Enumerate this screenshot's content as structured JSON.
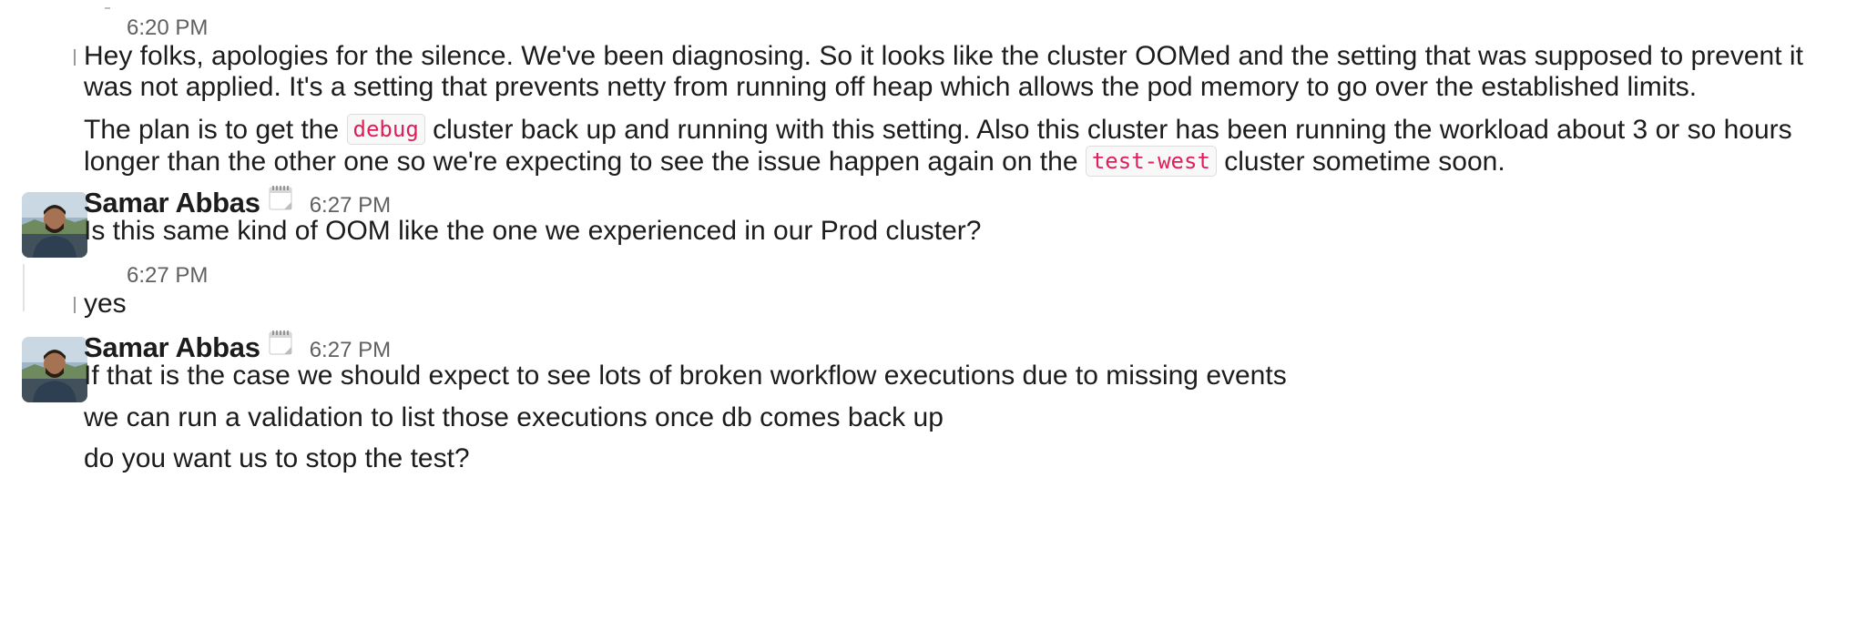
{
  "messages": [
    {
      "timestamp": "6:20 PM",
      "paragraphs": [
        {
          "line1": "Hey folks, apologies for the silence. We've been diagnosing. So it looks like the cluster OOMed and the setting that was supposed to prevent it",
          "line2": "was not applied. It's a setting that prevents netty from running off heap which allows the pod memory to go over the established limits."
        },
        {
          "line1_before": "The plan is to get the ",
          "line1_code": "debug",
          "line1_after": " cluster back up and running with this setting. Also this cluster has been running the workload about 3 or so hours",
          "line2_before": "longer than the other one so we're expecting to see the issue happen again on the ",
          "line2_code": "test-west",
          "line2_after": " cluster sometime soon."
        }
      ]
    },
    {
      "author": "Samar Abbas",
      "status_icon": "calendar-icon",
      "timestamp": "6:27 PM",
      "text": "Is this same kind of OOM like the one we experienced in our Prod cluster?"
    },
    {
      "timestamp": "6:27 PM",
      "text": "yes"
    },
    {
      "author": "Samar Abbas",
      "status_icon": "calendar-icon",
      "timestamp": "6:27 PM",
      "lines": [
        "If that is the case we should expect to see lots of broken workflow executions due to missing events",
        "we can run a validation to list those executions once db comes back up",
        "do you want us to stop the test?"
      ]
    }
  ],
  "colors": {
    "text": "#1d1c1d",
    "timestamp": "#616061",
    "code_text": "#e01e5a",
    "code_bg": "#f8f8f8"
  }
}
